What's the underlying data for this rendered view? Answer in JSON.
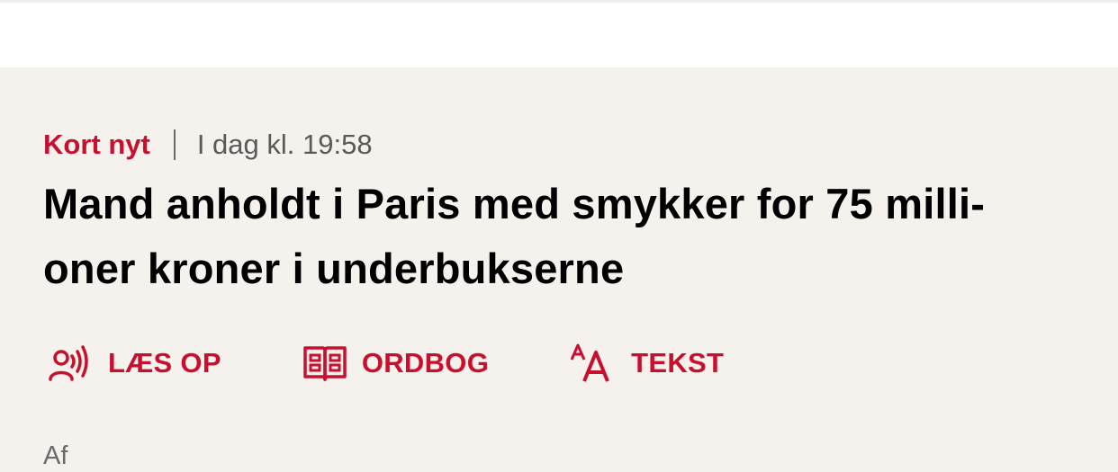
{
  "article": {
    "category": "Kort nyt",
    "timestamp": "I dag kl. 19:58",
    "headline_line1": "Mand anholdt i Paris med smykker for 75 milli-",
    "headline_line2": "oner kroner i underbukserne",
    "byline_prefix": "Af"
  },
  "toolbar": {
    "read_aloud": {
      "label": "LÆS OP",
      "icon": "read-aloud-icon"
    },
    "dictionary": {
      "label": "ORDBOG",
      "icon": "dictionary-book-icon"
    },
    "text_size": {
      "label": "TEKST",
      "icon": "text-size-icon"
    }
  },
  "colors": {
    "accent": "#c8102e",
    "background": "#f5f2ed",
    "header": "#ffffff",
    "headline": "#000000",
    "muted": "#5a5a5a"
  }
}
